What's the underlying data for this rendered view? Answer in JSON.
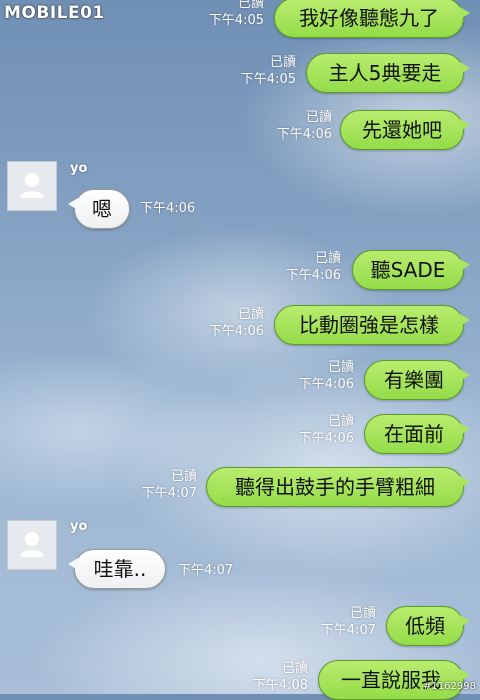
{
  "branding": {
    "logo_text": "MOBILE01",
    "watermark": "#1162998"
  },
  "read_label": "已讀",
  "incoming_sender": "yo",
  "colors": {
    "outgoing_bubble": "#9fe04f",
    "incoming_bubble": "#ffffff",
    "meta_text": "#ffffff"
  },
  "messages": [
    {
      "direction": "out",
      "text": "我好像聽態九了",
      "time": "下午4:05",
      "read": "已讀"
    },
    {
      "direction": "out",
      "text": "主人5典要走",
      "time": "下午4:05",
      "read": "已讀"
    },
    {
      "direction": "out",
      "text": "先還她吧",
      "time": "下午4:06",
      "read": "已讀"
    },
    {
      "direction": "in",
      "sender": "yo",
      "text": "嗯",
      "time": "下午4:06"
    },
    {
      "direction": "out",
      "text": "聽SADE",
      "time": "下午4:06",
      "read": "已讀"
    },
    {
      "direction": "out",
      "text": "比動圈強是怎樣",
      "time": "下午4:06",
      "read": "已讀"
    },
    {
      "direction": "out",
      "text": "有樂團",
      "time": "下午4:06",
      "read": "已讀"
    },
    {
      "direction": "out",
      "text": "在面前",
      "time": "下午4:06",
      "read": "已讀"
    },
    {
      "direction": "out",
      "text": "聽得出鼓手的手臂粗細",
      "time": "下午4:07",
      "read": "已讀"
    },
    {
      "direction": "in",
      "sender": "yo",
      "text": "哇靠..",
      "time": "下午4:07"
    },
    {
      "direction": "out",
      "text": "低頻",
      "time": "下午4:07",
      "read": "已讀"
    },
    {
      "direction": "out",
      "text": "一直說服我",
      "time": "下午4:08",
      "read": "已讀"
    }
  ]
}
